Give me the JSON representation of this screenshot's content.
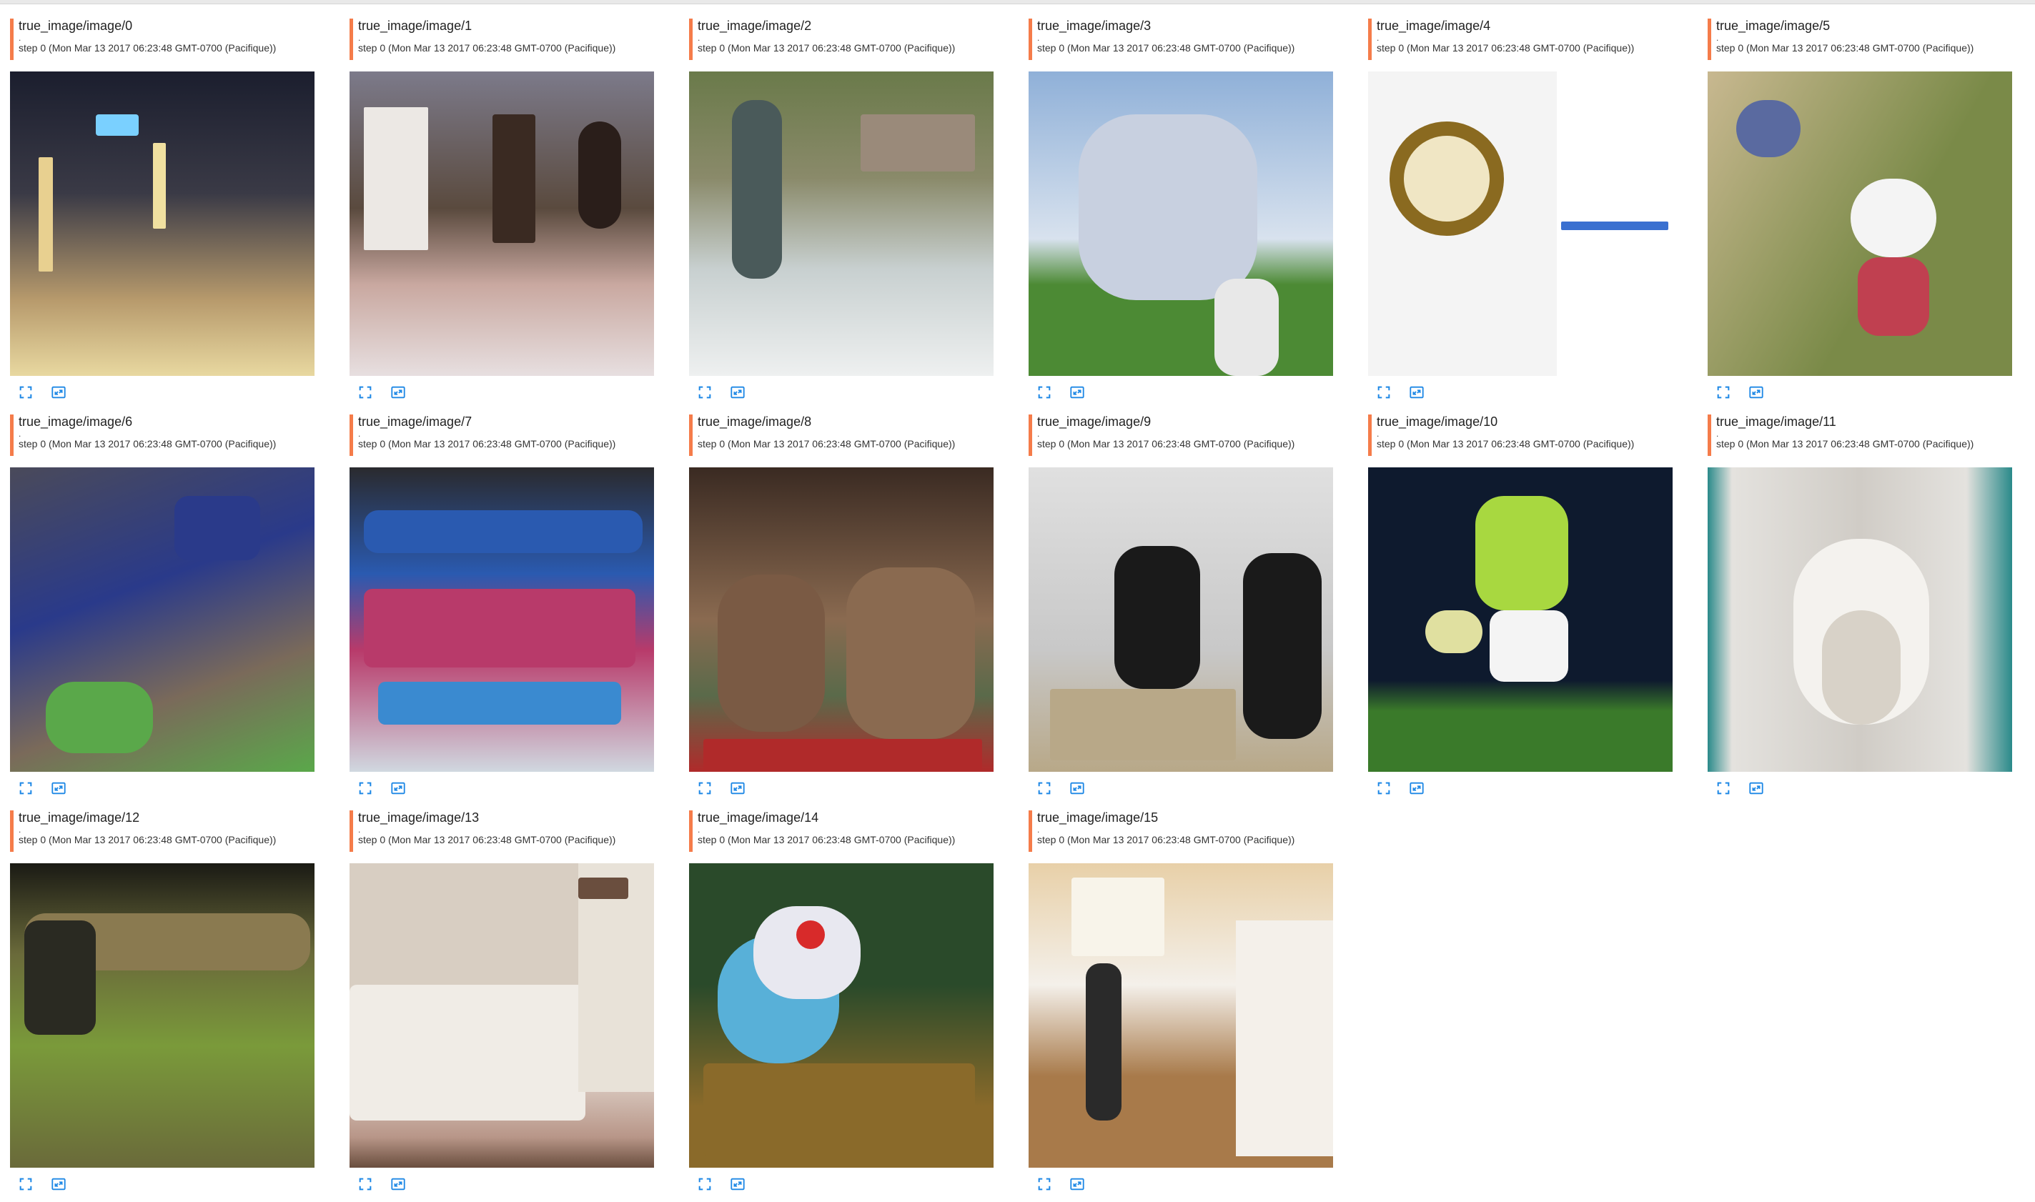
{
  "cards": [
    {
      "title": "true_image/image/0",
      "dot": ".",
      "step": "step 0 (Mon Mar 13 2017 06:23:48 GMT-0700 (Pacifique))",
      "scene": "night street with lights",
      "colors": [
        "#1b1e2e",
        "#3a3a46",
        "#b79a6c",
        "#e8d8a0"
      ]
    },
    {
      "title": "true_image/image/1",
      "dot": ".",
      "step": "step 0 (Mon Mar 13 2017 06:23:48 GMT-0700 (Pacifique))",
      "scene": "bedroom with bed",
      "colors": [
        "#7c7a8a",
        "#5a4a3e",
        "#c9a8a0",
        "#e7dfe0"
      ]
    },
    {
      "title": "true_image/image/2",
      "dot": ".",
      "step": "step 0 (Mon Mar 13 2017 06:23:48 GMT-0700 (Pacifique))",
      "scene": "water skier",
      "colors": [
        "#6a7a4a",
        "#8a8a6a",
        "#c8d0d0",
        "#eef0f0"
      ]
    },
    {
      "title": "true_image/image/3",
      "dot": ".",
      "step": "step 0 (Mon Mar 13 2017 06:23:48 GMT-0700 (Pacifique))",
      "scene": "star kite in sky",
      "colors": [
        "#8fb0d8",
        "#d8e2ee",
        "#3a62b8",
        "#4c8a34"
      ]
    },
    {
      "title": "true_image/image/4",
      "dot": ".",
      "step": "step 0 (Mon Mar 13 2017 06:23:48 GMT-0700 (Pacifique))",
      "scene": "clock screenshot",
      "colors": [
        "#f4f4f4",
        "#c8a050",
        "#e8e0c0",
        "#3a70d0"
      ]
    },
    {
      "title": "true_image/image/5",
      "dot": ".",
      "step": "step 0 (Mon Mar 13 2017 06:23:48 GMT-0700 (Pacifique))",
      "scene": "child with fire hydrant",
      "colors": [
        "#7a8a48",
        "#c8b890",
        "#3a3e7a",
        "#c04050"
      ]
    },
    {
      "title": "true_image/image/6",
      "dot": ".",
      "step": "step 0 (Mon Mar 13 2017 06:23:48 GMT-0700 (Pacifique))",
      "scene": "cluttered room",
      "colors": [
        "#4a4a5a",
        "#2a3a8a",
        "#7a6a5a",
        "#5aa84a"
      ]
    },
    {
      "title": "true_image/image/7",
      "dot": ".",
      "step": "step 0 (Mon Mar 13 2017 06:23:48 GMT-0700 (Pacifique))",
      "scene": "colorful boats",
      "colors": [
        "#2a2a2e",
        "#2a5ab0",
        "#b83a6a",
        "#d0d8e0"
      ]
    },
    {
      "title": "true_image/image/8",
      "dot": ".",
      "step": "step 0 (Mon Mar 13 2017 06:23:48 GMT-0700 (Pacifique))",
      "scene": "two women at table",
      "colors": [
        "#3a2a22",
        "#8a6a50",
        "#5a6a4a",
        "#b02a2a"
      ]
    },
    {
      "title": "true_image/image/9",
      "dot": ".",
      "step": "step 0 (Mon Mar 13 2017 06:23:48 GMT-0700 (Pacifique))",
      "scene": "two black cats",
      "colors": [
        "#e0e0e0",
        "#c8c8c8",
        "#1a1a1a",
        "#b8a888"
      ]
    },
    {
      "title": "true_image/image/10",
      "dot": ".",
      "step": "step 0 (Mon Mar 13 2017 06:23:48 GMT-0700 (Pacifique))",
      "scene": "tennis player",
      "colors": [
        "#0e1a2e",
        "#a8d840",
        "#d0b090",
        "#3a7a2a"
      ]
    },
    {
      "title": "true_image/image/11",
      "dot": ".",
      "step": "step 0 (Mon Mar 13 2017 06:23:48 GMT-0700 (Pacifique))",
      "scene": "toilet",
      "colors": [
        "#e4e2de",
        "#d0ccc6",
        "#2a8a8a",
        "#6a5a4a"
      ]
    },
    {
      "title": "true_image/image/12",
      "dot": ".",
      "step": "step 0 (Mon Mar 13 2017 06:23:48 GMT-0700 (Pacifique))",
      "scene": "giraffe lying in grass",
      "colors": [
        "#1a1a14",
        "#6a6a3a",
        "#7a9a3a",
        "#b8a078"
      ]
    },
    {
      "title": "true_image/image/13",
      "dot": ".",
      "step": "step 0 (Mon Mar 13 2017 06:23:48 GMT-0700 (Pacifique))",
      "scene": "bed in room",
      "colors": [
        "#d8cec2",
        "#f0ece6",
        "#b89688",
        "#6a4e3e"
      ]
    },
    {
      "title": "true_image/image/14",
      "dot": ".",
      "step": "step 0 (Mon Mar 13 2017 06:23:48 GMT-0700 (Pacifique))",
      "scene": "teapot still life",
      "colors": [
        "#2a4a2a",
        "#58b0d8",
        "#e8e8f0",
        "#8a6a2a"
      ]
    },
    {
      "title": "true_image/image/15",
      "dot": ".",
      "step": "step 0 (Mon Mar 13 2017 06:23:48 GMT-0700 (Pacifique))",
      "scene": "kitchen hallway",
      "colors": [
        "#e8d0a8",
        "#a87a4a",
        "#f4f0ea",
        "#2a2a2a"
      ]
    }
  ],
  "icons": {
    "fullscreen": "fullscreen-icon",
    "fit": "fit-image-icon"
  },
  "accent": "#f57c4a",
  "icon_color": "#1e88e5"
}
